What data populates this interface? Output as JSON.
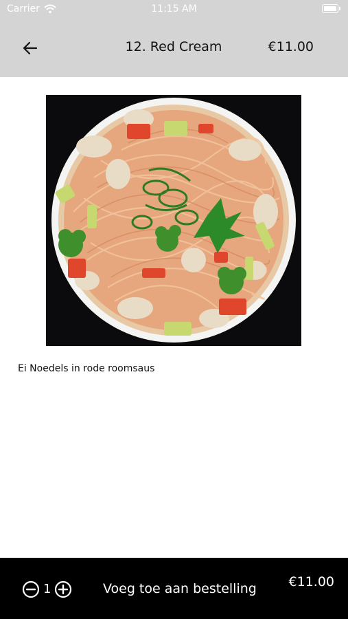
{
  "status_bar": {
    "carrier": "Carrier",
    "time": "11:15 AM"
  },
  "nav": {
    "title": "12. Red Cream",
    "price": "€11.00"
  },
  "dish": {
    "description": "Ei Noedels in rode roomsaus"
  },
  "order_bar": {
    "quantity": "1",
    "add_label": "Voeg toe aan bestelling",
    "price": "€11.00"
  },
  "colors": {
    "header_bg": "#d4d4d4",
    "bottom_bar_bg": "#000000",
    "image_bg": "#0b0b0d"
  },
  "icons": {
    "back": "arrow-left-icon",
    "minus": "circle-minus-icon",
    "plus": "circle-plus-icon",
    "wifi": "wifi-icon",
    "battery": "battery-icon"
  }
}
